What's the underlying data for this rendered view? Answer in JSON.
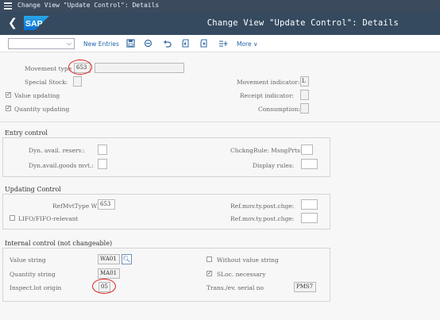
{
  "window": {
    "title": "Change View \"Update Control\": Details"
  },
  "shell": {
    "back_glyph": "❮",
    "logo_text": "SAP",
    "title": "Change View \"Update Control\": Details"
  },
  "toolbar": {
    "dropdown_value": "",
    "new_entries": "New Entries",
    "more": "More ∨",
    "icons": [
      "save-icon",
      "deselect-icon",
      "undo-icon",
      "previous-entry-icon",
      "next-entry-icon",
      "customizing-icon"
    ]
  },
  "header": {
    "movement_type_label": "Movement type",
    "movement_type_value": "653",
    "movement_type_text": "",
    "special_stock_label": "Special Stock:",
    "special_stock_value": "",
    "movement_indicator_label": "Movement indicator:",
    "movement_indicator_value": "L",
    "value_updating_label": "Value updating",
    "receipt_indicator_label": "Receipt indicator:",
    "receipt_indicator_value": "",
    "quantity_updating_label": "Quantity updating",
    "consumption_label": "Consumption:",
    "consumption_value": ""
  },
  "entry_control": {
    "title": "Entry control",
    "dyn_avail_reserv_label": "Dyn. avail. reserv.:",
    "dyn_avail_goods_label": "Dyn.avail.goods mvt.:",
    "chckng_rule_label": "ChckngRule: MsngPrts:",
    "display_rules_label": "Display rules:"
  },
  "updating_control": {
    "title": "Updating Control",
    "ref_mvt_type_wm_label": "RefMvtType WM:",
    "ref_mvt_type_wm_value": "653",
    "ref_mov_1_label": "Ref.mov.ty.post.chge:",
    "ref_mov_2_label": "Ref.mov.ty.post.chge:",
    "lifo_label": "LIFO/FIFO-relevant"
  },
  "internal_control": {
    "title": "Internal control (not changeable)",
    "value_string_label": "Value string",
    "value_string_value": "WA01",
    "quantity_string_label": "Quantity string",
    "quantity_string_value": "MA01",
    "inspect_lot_label": "Inspect.lot origin",
    "inspect_lot_value": "05",
    "without_value_string_label": "Without value string",
    "sloc_necessary_label": "SLoc. necessary",
    "trans_ev_label": "Trans./ev. serial no",
    "trans_ev_value": "PMS7"
  },
  "colors": {
    "shell": "#354a5f",
    "titlebar": "#3c4a5e",
    "accent": "#2266aa",
    "highlight": "#dd2222"
  }
}
